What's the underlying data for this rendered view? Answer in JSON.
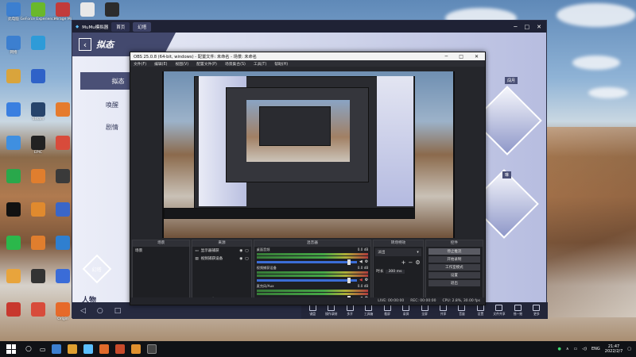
{
  "desktop": {
    "icons": [
      {
        "label": "此电脑",
        "color": "#3c7fd0",
        "col": 0,
        "row": 0
      },
      {
        "label": "GeForce Experience",
        "color": "#6ab82b",
        "col": 1,
        "row": 0
      },
      {
        "label": "Mirage Mi",
        "color": "#c23b3b",
        "col": 2,
        "row": 0
      },
      {
        "label": "",
        "color": "#e8e8e8",
        "col": 3,
        "row": 0
      },
      {
        "label": "",
        "color": "#2c2c2c",
        "col": 4,
        "row": 0
      },
      {
        "label": "网络",
        "color": "#3c7fd0",
        "col": 0,
        "row": 1
      },
      {
        "label": "",
        "color": "#2e9bd8",
        "col": 1,
        "row": 1
      },
      {
        "label": "",
        "color": "#d9a43c",
        "col": 0,
        "row": 2
      },
      {
        "label": "",
        "color": "#2f62c8",
        "col": 1,
        "row": 2
      },
      {
        "label": "",
        "color": "#3a7fe0",
        "col": 0,
        "row": 3
      },
      {
        "label": "Steam",
        "color": "#27446b",
        "col": 1,
        "row": 3
      },
      {
        "label": "",
        "color": "#e57b2d",
        "col": 2,
        "row": 3
      },
      {
        "label": "",
        "color": "#3f8fe0",
        "col": 0,
        "row": 4
      },
      {
        "label": "EPIC",
        "color": "#222",
        "col": 1,
        "row": 4
      },
      {
        "label": "",
        "color": "#d84b3b",
        "col": 2,
        "row": 4
      },
      {
        "label": "",
        "color": "#29a84b",
        "col": 0,
        "row": 5
      },
      {
        "label": "",
        "color": "#e07e2e",
        "col": 1,
        "row": 5
      },
      {
        "label": "",
        "color": "#3a3a3a",
        "col": 2,
        "row": 5
      },
      {
        "label": "",
        "color": "#111",
        "col": 0,
        "row": 6
      },
      {
        "label": "",
        "color": "#e08a2e",
        "col": 1,
        "row": 6
      },
      {
        "label": "",
        "color": "#3a66c8",
        "col": 2,
        "row": 6
      },
      {
        "label": "",
        "color": "#2bb84b",
        "col": 0,
        "row": 7
      },
      {
        "label": "",
        "color": "#e07e2e",
        "col": 1,
        "row": 7
      },
      {
        "label": "",
        "color": "#2f7fd0",
        "col": 2,
        "row": 7
      },
      {
        "label": "",
        "color": "#e8a43c",
        "col": 0,
        "row": 8
      },
      {
        "label": "",
        "color": "#333",
        "col": 1,
        "row": 8
      },
      {
        "label": "",
        "color": "#3a6cd8",
        "col": 2,
        "row": 8
      },
      {
        "label": "",
        "color": "#c8382e",
        "col": 0,
        "row": 9
      },
      {
        "label": "",
        "color": "#d84b3b",
        "col": 1,
        "row": 9
      },
      {
        "label": "Origin",
        "color": "#e66a2a",
        "col": 2,
        "row": 9
      },
      {
        "label": "",
        "color": "#3a3a3a",
        "col": 3,
        "row": 9
      }
    ]
  },
  "mumu": {
    "title": "MuMu模拟器",
    "tabs": [
      "首页",
      "幻塔"
    ],
    "window_controls": [
      "─",
      "□",
      "✕"
    ],
    "game": {
      "page_title": "拟态",
      "nav": [
        {
          "label": "拟态",
          "selected": true
        },
        {
          "label": "唤醒",
          "selected": false
        },
        {
          "label": "剧情",
          "selected": false
        }
      ],
      "portrait_labels": [
        "闯月",
        "琳"
      ],
      "bottom_label": "人物",
      "bottom_logo": "幻塔"
    },
    "android_nav": [
      "◁",
      "○",
      "□"
    ],
    "tools": [
      "键盘",
      "操作录制",
      "多开",
      "工具箱",
      "截屏",
      "录屏",
      "全屏",
      "共享",
      "音量",
      "设置",
      "文件共享",
      "摇一摇",
      "更多"
    ]
  },
  "obs": {
    "title": "OBS 25.0.8 (64-bit, windows) - 配置文件: 未命名 - 场景: 未命名",
    "menu": [
      "文件(F)",
      "编辑(E)",
      "视图(V)",
      "配置文件(P)",
      "场景集合(S)",
      "工具(T)",
      "帮助(H)"
    ],
    "docks": {
      "scenes": {
        "header": "场景",
        "items": [
          "场景"
        ]
      },
      "sources": {
        "header": "来源",
        "items": [
          "显示器捕获",
          "视频捕获设备"
        ]
      },
      "mixer": {
        "header": "混音器",
        "channels": [
          {
            "name": "桌面音频",
            "db": "0.0 dB"
          },
          {
            "name": "视频捕获设备",
            "db": "0.0 dB"
          },
          {
            "name": "麦克风/Aux",
            "db": "0.0 dB"
          }
        ]
      },
      "transitions": {
        "header": "转场特效",
        "type": "淡出",
        "duration_label": "时长",
        "duration": "300 ms"
      },
      "controls": {
        "header": "控件",
        "buttons": [
          "停止推流",
          "开始录制",
          "工作室模式",
          "设置",
          "退出"
        ]
      }
    },
    "status": [
      "LIVE: 00:00:00",
      "REC: 00:00:00",
      "CPU: 2.8%, 30.00 fps"
    ]
  },
  "taskbar": {
    "tray": [
      "ENG"
    ],
    "time": "21:47",
    "date": "2022/2/7"
  }
}
